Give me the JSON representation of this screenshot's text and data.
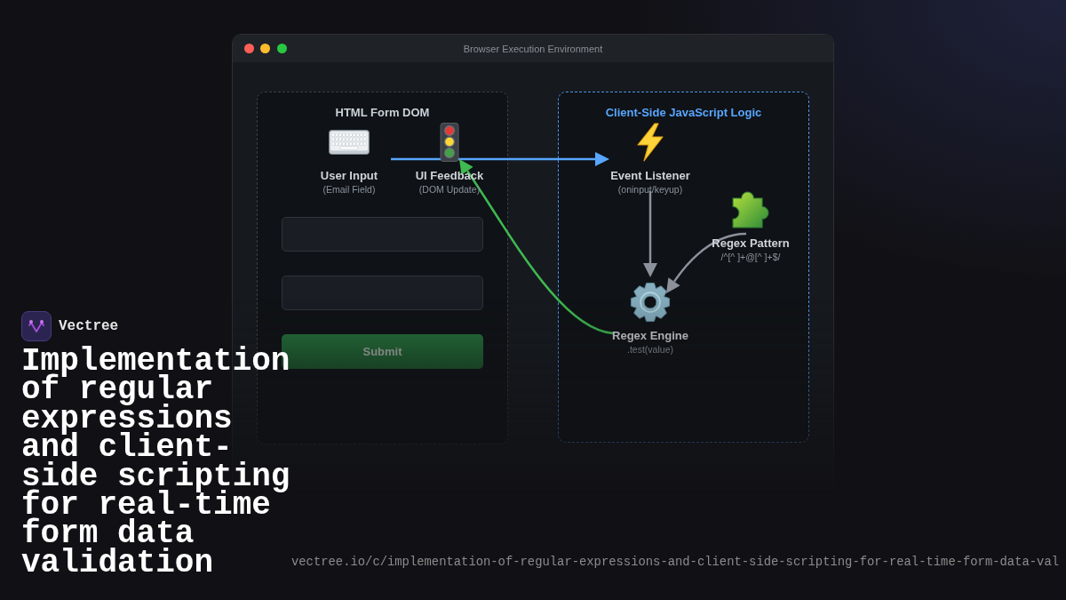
{
  "window": {
    "title": "Browser Execution Environment",
    "controls": [
      {
        "kind": "close"
      },
      {
        "kind": "minimize"
      },
      {
        "kind": "zoom"
      }
    ]
  },
  "panels": [
    {
      "kind": "dom",
      "title": "HTML Form DOM",
      "nodes": [
        {
          "kind": "input",
          "label": "User Input",
          "sublabel": "(Email Field)"
        },
        {
          "kind": "feedback",
          "label": "UI Feedback",
          "sublabel": "(DOM Update)"
        }
      ],
      "controls": [
        {
          "kind": "input"
        },
        {
          "kind": "input"
        },
        {
          "kind": "button",
          "label": "Submit"
        }
      ]
    },
    {
      "kind": "logic",
      "title": "Client-Side JavaScript Logic",
      "nodes": [
        {
          "kind": "listener",
          "label": "Event Listener",
          "sublabel": "(oninput/keyup)"
        },
        {
          "kind": "pattern",
          "label": "Regex Pattern",
          "sublabel": "/^[^ ]+@[^ ]+$/"
        },
        {
          "kind": "engine",
          "label": "Regex Engine",
          "sublabel": ".test(value)"
        }
      ]
    }
  ],
  "edges": [
    {
      "kind": "forward",
      "color": "#58a6ff"
    },
    {
      "kind": "down",
      "color": "#8b929c"
    },
    {
      "kind": "merge",
      "color": "#8b929c"
    },
    {
      "kind": "back",
      "color": "#3fb950"
    }
  ],
  "brand": {
    "name": "Vectree"
  },
  "title": "Implementation of regular expressions and client-side scripting for real-time form data validation",
  "url": "vectree.io/c/implementation-of-regular-expressions-and-client-side-scripting-for-real-time-form-data-val"
}
